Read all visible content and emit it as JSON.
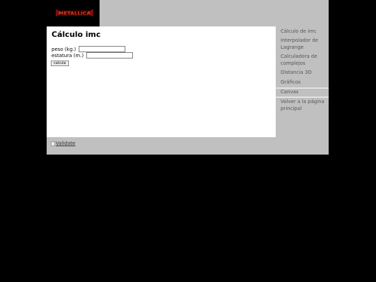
{
  "header": {
    "logo_text": "METALLICA"
  },
  "main": {
    "title": "Cálculo imc",
    "fields": {
      "peso_label": "peso (kg.)",
      "peso_value": "",
      "estatura_label": "estatura (m.)",
      "estatura_value": ""
    },
    "button_label": "calcula"
  },
  "sidebar": {
    "items": [
      {
        "label": "Cálculo de imc"
      },
      {
        "label": "Interpolador de Lagrange"
      },
      {
        "label": "Calculadora de complejos"
      },
      {
        "label": "Distancia 3D"
      },
      {
        "label": "Gráficos"
      },
      {
        "label": "Canvas"
      },
      {
        "label": "Volver a la página principal"
      }
    ]
  },
  "footer": {
    "validate_label": "Validate"
  },
  "colors": {
    "page_background": "#000000",
    "panel_gray": "#c0c0c0",
    "content_white": "#ffffff",
    "nav_text": "#555555",
    "logo_red": "#c21d12"
  }
}
